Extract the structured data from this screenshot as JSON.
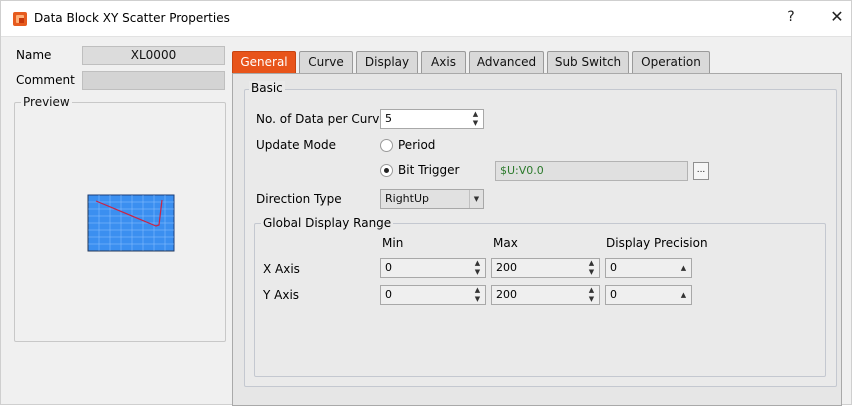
{
  "window": {
    "title": "Data Block XY Scatter Properties",
    "help": "?",
    "close": "✕"
  },
  "left": {
    "name_label": "Name",
    "name_value": "XL0000",
    "comment_label": "Comment",
    "comment_value": "",
    "preview_label": "Preview"
  },
  "tabs": [
    {
      "label": "General",
      "active": true
    },
    {
      "label": "Curve"
    },
    {
      "label": "Display"
    },
    {
      "label": "Axis"
    },
    {
      "label": "Advanced"
    },
    {
      "label": "Sub Switch"
    },
    {
      "label": "Operation"
    }
  ],
  "general": {
    "basic_label": "Basic",
    "data_per_curve_label": "No. of Data per Curve",
    "data_per_curve_value": "5",
    "update_mode_label": "Update Mode",
    "update_mode_options": [
      {
        "label": "Period",
        "selected": false
      },
      {
        "label": "Bit Trigger",
        "selected": true
      }
    ],
    "bit_trigger_address": "$U:V0.0",
    "browse_label": "...",
    "direction_type_label": "Direction Type",
    "direction_type_value": "RightUp",
    "global_range": {
      "label": "Global Display Range",
      "col_min": "Min",
      "col_max": "Max",
      "col_precision": "Display Precision",
      "rows": [
        {
          "label": "X Axis",
          "min": "0",
          "max": "200",
          "precision": "0"
        },
        {
          "label": "Y Axis",
          "min": "0",
          "max": "200",
          "precision": "0"
        }
      ]
    }
  },
  "colors": {
    "accent_tab": "#e8541a",
    "preview_plot": "#3b8ff0",
    "preview_line": "#cc2244",
    "address_text": "#2c7a2c"
  },
  "icons": {
    "app": "scatter-app-icon",
    "help": "help-icon",
    "close": "close-icon",
    "spin": "spin-arrows-icon",
    "dropdown": "chevron-down-icon"
  }
}
